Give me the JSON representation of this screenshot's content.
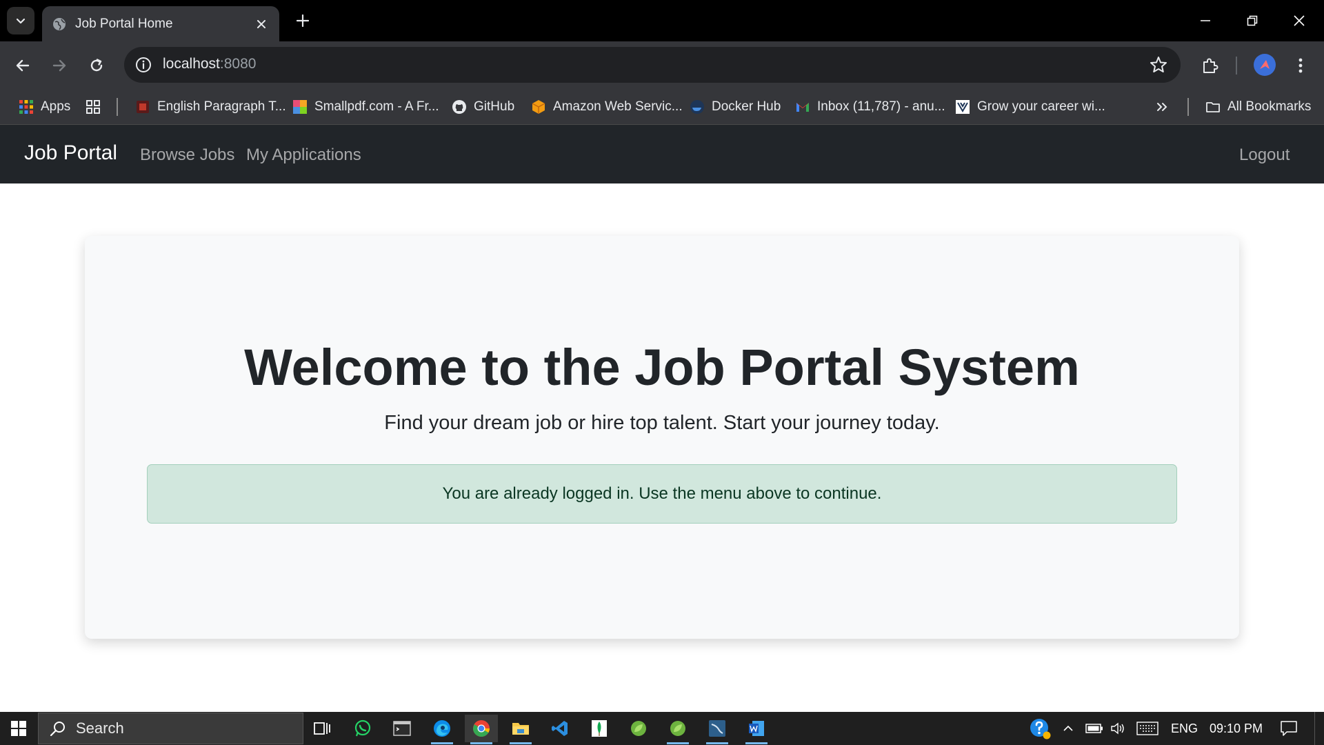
{
  "browser": {
    "tab_title": "Job Portal Home",
    "url_host": "localhost",
    "url_port": ":8080"
  },
  "bookmarks": [
    {
      "label": "Apps",
      "icon": "apps-grid-icon"
    },
    {
      "label": "English Paragraph T...",
      "icon": "site-favicon-red-icon"
    },
    {
      "label": "Smallpdf.com - A Fr...",
      "icon": "smallpdf-icon"
    },
    {
      "label": "GitHub",
      "icon": "github-icon"
    },
    {
      "label": "Amazon Web Servic...",
      "icon": "aws-cube-icon"
    },
    {
      "label": "Docker Hub",
      "icon": "docker-icon"
    },
    {
      "label": "Inbox (11,787) - anu...",
      "icon": "gmail-icon"
    },
    {
      "label": "Grow your career wi...",
      "icon": "career-site-icon"
    }
  ],
  "bookmarks_all": "All Bookmarks",
  "site": {
    "brand": "Job Portal",
    "nav": [
      "Browse Jobs",
      "My Applications"
    ],
    "logout": "Logout"
  },
  "hero": {
    "title": "Welcome to the Job Portal System",
    "subtitle": "Find your dream job or hire top talent. Start your journey today.",
    "alert": "You are already logged in. Use the menu above to continue."
  },
  "taskbar": {
    "search_placeholder": "Search",
    "language": "ENG",
    "time": "09:10 PM"
  },
  "colors": {
    "navbar_bg": "#212529",
    "alert_bg": "#d1e7dd",
    "alert_text": "#0a3622",
    "card_bg": "#f8f9fa"
  }
}
